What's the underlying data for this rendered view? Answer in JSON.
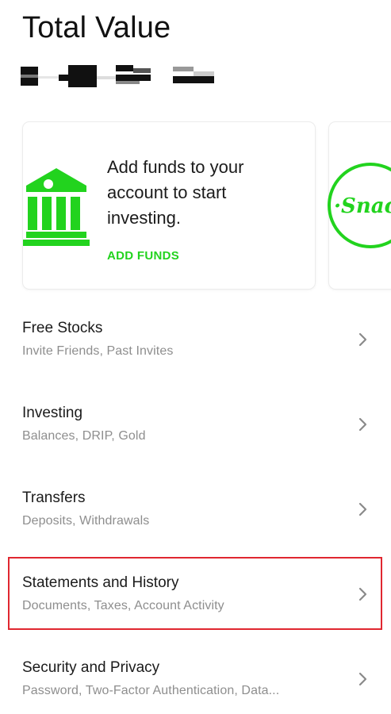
{
  "header": {
    "title": "Total Value"
  },
  "promo_cards": {
    "funds": {
      "text": "Add funds to your account to start investing.",
      "button_label": "ADD FUNDS"
    },
    "snacks": {
      "logo_text": "Snacks"
    }
  },
  "colors": {
    "accent_green": "#22d31e",
    "highlight_red": "#e02730",
    "subtitle_gray": "#8e8e8e"
  },
  "menu": [
    {
      "title": "Free Stocks",
      "subtitle": "Invite Friends, Past Invites"
    },
    {
      "title": "Investing",
      "subtitle": "Balances, DRIP, Gold"
    },
    {
      "title": "Transfers",
      "subtitle": "Deposits, Withdrawals"
    },
    {
      "title": "Statements and History",
      "subtitle": "Documents, Taxes, Account Activity"
    },
    {
      "title": "Security and Privacy",
      "subtitle": "Password, Two-Factor Authentication, Data..."
    }
  ]
}
